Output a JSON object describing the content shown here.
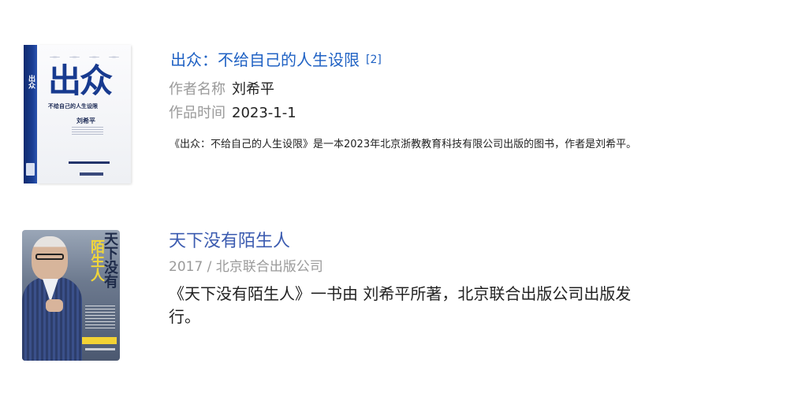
{
  "results": [
    {
      "cover": {
        "spine_text": "出众",
        "big_title": "出众",
        "subtitle": "不给自己的人生设限",
        "author": "刘希平"
      },
      "title": "出众：不给自己的人生设限",
      "ref": "[2]",
      "author_label": "作者名称",
      "author": "刘希平",
      "time_label": "作品时间",
      "time": "2023-1-1",
      "description": "《出众：不给自己的人生设限》是一本2023年北京浙教教育科技有限公司出版的图书，作者是刘希平。"
    },
    {
      "cover": {
        "title_a": "天下没有",
        "title_b": "陌生人"
      },
      "title": "天下没有陌生人",
      "subtitle": "2017 / 北京联合出版公司",
      "description": "《天下没有陌生人》一书由 刘希平所著，北京联合出版公司出版发行。"
    }
  ]
}
